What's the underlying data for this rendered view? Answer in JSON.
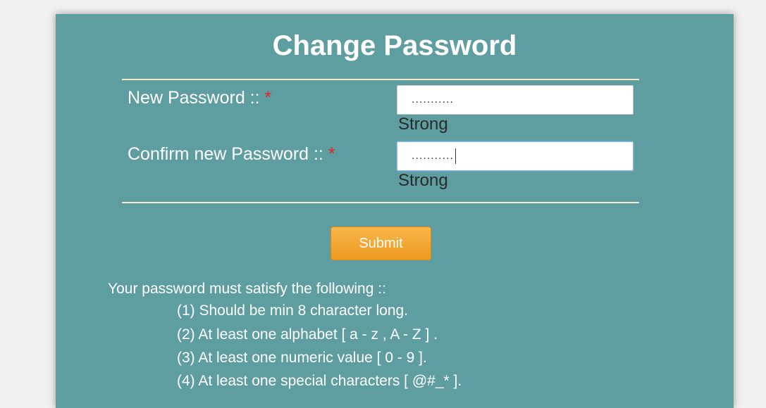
{
  "form": {
    "title": "Change Password",
    "new_password_label": "New Password :: ",
    "confirm_password_label": "Confirm new Password :: ",
    "required_marker": "*",
    "new_password_value": "...........",
    "confirm_password_value": "...........",
    "new_password_strength": "Strong",
    "confirm_password_strength": "Strong",
    "submit_label": "Submit"
  },
  "requirements": {
    "heading": "Your password must satisfy the following ::",
    "items": [
      "(1) Should be min 8 character long.",
      "(2) At least one alphabet [ a - z , A - Z ] .",
      "(3) At least one numeric value [ 0 - 9 ].",
      "(4) At least one special characters [ @#_* ]."
    ]
  },
  "colors": {
    "panel_background": "#5f9ea0",
    "divider": "#f3e7c9",
    "submit_button": "#f0a030",
    "required_marker": "#e0282a"
  }
}
